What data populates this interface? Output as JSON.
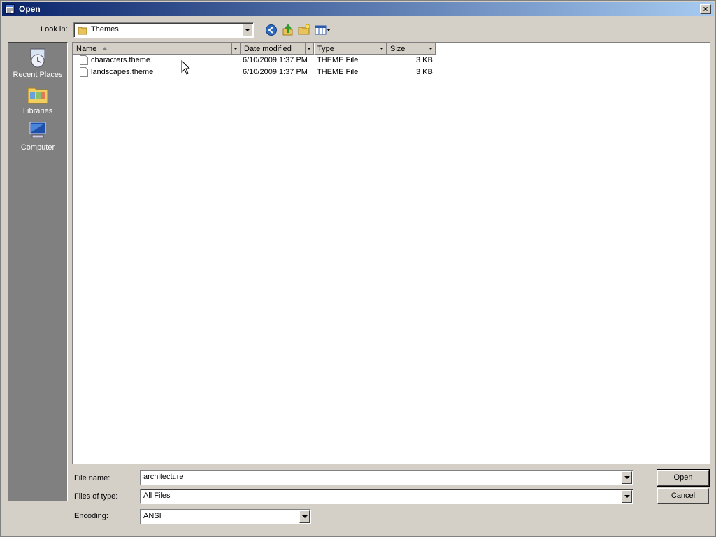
{
  "window": {
    "title": "Open"
  },
  "toolbar": {
    "look_in_label": "Look in:",
    "look_in_value": "Themes",
    "buttons": [
      "back-icon",
      "up-folder-icon",
      "new-folder-icon",
      "view-menu-icon"
    ]
  },
  "places": [
    {
      "label": "Recent Places",
      "icon": "recent-places-icon"
    },
    {
      "label": "Libraries",
      "icon": "libraries-icon"
    },
    {
      "label": "Computer",
      "icon": "computer-icon"
    }
  ],
  "columns": [
    "Name",
    "Date modified",
    "Type",
    "Size"
  ],
  "files": [
    {
      "name": "characters.theme",
      "date": "6/10/2009 1:37 PM",
      "type": "THEME File",
      "size": "3 KB"
    },
    {
      "name": "landscapes.theme",
      "date": "6/10/2009 1:37 PM",
      "type": "THEME File",
      "size": "3 KB"
    }
  ],
  "form": {
    "file_name_label": "File name:",
    "file_name_value": "architecture",
    "file_type_label": "Files of type:",
    "file_type_value": "All Files",
    "encoding_label": "Encoding:",
    "encoding_value": "ANSI"
  },
  "buttons": {
    "open": "Open",
    "cancel": "Cancel",
    "close": "×"
  },
  "colors": {
    "title_start": "#0a246a",
    "title_end": "#a6caf0",
    "face": "#d4d0c8",
    "places_bg": "#808080"
  }
}
